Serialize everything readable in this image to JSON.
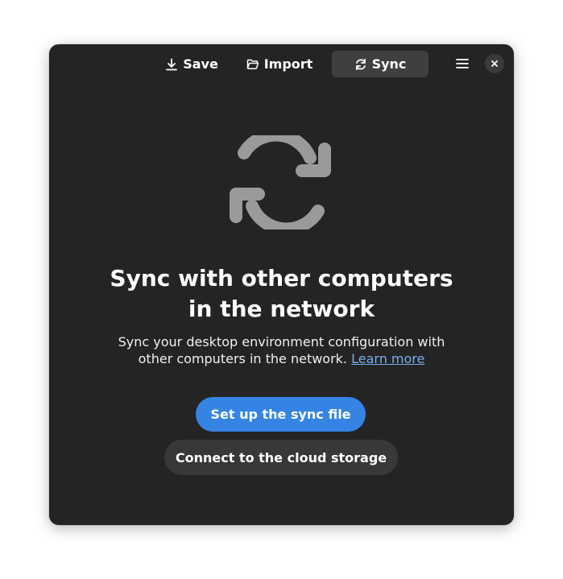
{
  "header": {
    "tabs": [
      {
        "label": "Save",
        "icon": "download-icon",
        "active": false
      },
      {
        "label": "Import",
        "icon": "folder-open-icon",
        "active": false
      },
      {
        "label": "Sync",
        "icon": "sync-icon",
        "active": true
      }
    ],
    "menu_icon": "hamburger-menu-icon",
    "close_icon": "close-icon"
  },
  "status_page": {
    "icon": "sync-icon",
    "title_line1": "Sync with other computers",
    "title_line2": "in the network",
    "description_line1": "Sync your desktop environment configuration with",
    "description_line2": "other computers in the network.",
    "link_label": "Learn more"
  },
  "actions": {
    "primary_label": "Set up the sync file",
    "secondary_label": "Connect to the cloud storage"
  },
  "colors": {
    "accent": "#3584e4",
    "link": "#78aeed",
    "window_bg": "#242424",
    "icon_gray": "#9a9a9a"
  }
}
